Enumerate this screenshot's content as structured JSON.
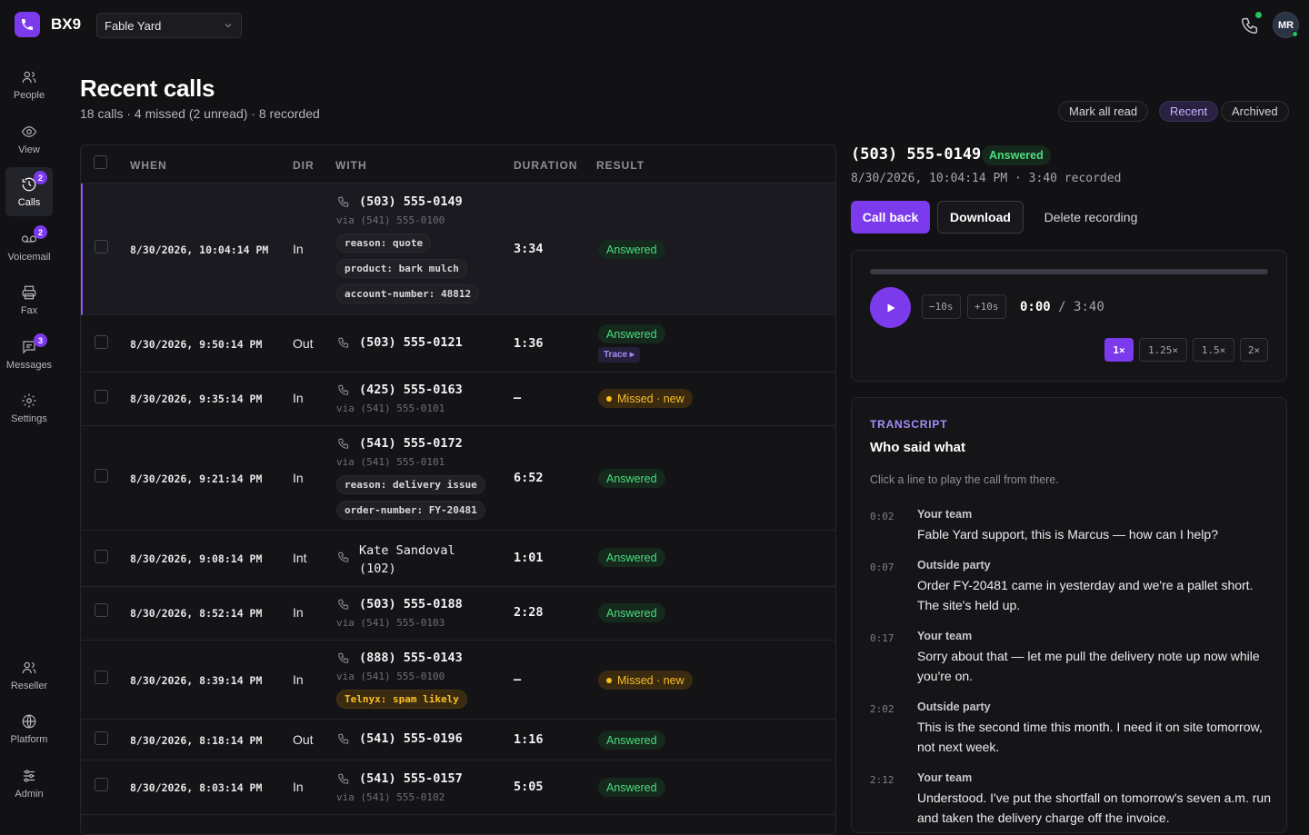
{
  "app": {
    "brand": "BX9",
    "tenant": "Fable Yard",
    "avatar_initials": "MR"
  },
  "sidebar": {
    "items": [
      {
        "label": "People",
        "icon": "people-icon"
      },
      {
        "label": "View",
        "icon": "eye-icon"
      },
      {
        "label": "Calls",
        "icon": "history-icon",
        "badge": "2",
        "active": true
      },
      {
        "label": "Voicemail",
        "icon": "voicemail-icon",
        "badge": "2"
      },
      {
        "label": "Fax",
        "icon": "printer-icon"
      },
      {
        "label": "Messages",
        "icon": "message-icon",
        "badge": "3"
      },
      {
        "label": "Settings",
        "icon": "gear-icon"
      }
    ],
    "bottom": [
      {
        "label": "Reseller",
        "icon": "reseller-icon"
      },
      {
        "label": "Platform",
        "icon": "globe-icon"
      },
      {
        "label": "Admin",
        "icon": "sliders-icon"
      }
    ]
  },
  "page": {
    "title": "Recent calls",
    "subtitle": "18 calls · 4 missed (2 unread) · 8 recorded",
    "actions": {
      "mark_all_read": "Mark all read",
      "recent": "Recent",
      "archived": "Archived"
    }
  },
  "table": {
    "headers": {
      "when": "WHEN",
      "dir": "DIR",
      "with": "WITH",
      "duration": "DURATION",
      "result": "RESULT"
    },
    "rows": [
      {
        "when": "8/30/2026, 10:04:14 PM",
        "dir": "In",
        "number": "(503) 555-0149",
        "via": "via (541) 555-0100",
        "tags": [
          "reason: quote",
          "product: bark mulch",
          "account-number: 48812"
        ],
        "duration": "3:34",
        "result": "Answered"
      },
      {
        "when": "8/30/2026, 9:50:14 PM",
        "dir": "Out",
        "number": "(503) 555-0121",
        "duration": "1:36",
        "result": "Answered",
        "extra": "Trace ▸"
      },
      {
        "when": "8/30/2026, 9:35:14 PM",
        "dir": "In",
        "number": "(425) 555-0163",
        "via": "via (541) 555-0101",
        "duration": "–",
        "result": "Missed · new"
      },
      {
        "when": "8/30/2026, 9:21:14 PM",
        "dir": "In",
        "number": "(541) 555-0172",
        "via": "via (541) 555-0101",
        "tags": [
          "reason: delivery issue",
          "order-number: FY-20481"
        ],
        "duration": "6:52",
        "result": "Answered"
      },
      {
        "when": "8/30/2026, 9:08:14 PM",
        "dir": "Int",
        "number": "Kate Sandoval",
        "number2": "(102)",
        "duration": "1:01",
        "result": "Answered"
      },
      {
        "when": "8/30/2026, 8:52:14 PM",
        "dir": "In",
        "number": "(503) 555-0188",
        "via": "via (541) 555-0103",
        "duration": "2:28",
        "result": "Answered"
      },
      {
        "when": "8/30/2026, 8:39:14 PM",
        "dir": "In",
        "number": "(888) 555-0143",
        "via": "via (541) 555-0100",
        "tags": [
          "Telnyx: spam likely"
        ],
        "duration": "–",
        "result": "Missed · new"
      },
      {
        "when": "8/30/2026, 8:18:14 PM",
        "dir": "Out",
        "number": "(541) 555-0196",
        "duration": "1:16",
        "result": "Answered"
      },
      {
        "when": "8/30/2026, 8:03:14 PM",
        "dir": "In",
        "number": "(541) 555-0157",
        "via": "via (541) 555-0102",
        "duration": "5:05",
        "result": "Answered"
      }
    ]
  },
  "detail": {
    "number": "(503) 555-0149",
    "status": "Answered",
    "meta": "8/30/2026, 10:04:14 PM · 3:40 recorded",
    "buttons": {
      "call_back": "Call back",
      "download": "Download",
      "delete": "Delete recording"
    },
    "player": {
      "back": "−10s",
      "fwd": "+10s",
      "current": "0:00",
      "sep": "/",
      "total": "3:40",
      "progress": 0,
      "speeds": [
        "1×",
        "1.25×",
        "1.5×",
        "2×"
      ],
      "speed_active": "1×"
    },
    "transcript": {
      "eyebrow": "TRANSCRIPT",
      "title": "Who said what",
      "hint": "Click a line to play the call from there.",
      "lines": [
        {
          "t": "0:02",
          "speaker": "Your team",
          "text": "Fable Yard support, this is Marcus — how can I help?"
        },
        {
          "t": "0:07",
          "speaker": "Outside party",
          "text": "Order FY-20481 came in yesterday and we're a pallet short. The site's held up."
        },
        {
          "t": "0:17",
          "speaker": "Your team",
          "text": "Sorry about that — let me pull the delivery note up now while you're on."
        },
        {
          "t": "2:02",
          "speaker": "Outside party",
          "text": "This is the second time this month. I need it on site tomorrow, not next week."
        },
        {
          "t": "2:12",
          "speaker": "Your team",
          "text": "Understood. I've put the shortfall on tomorrow's seven a.m. run and taken the delivery charge off the invoice."
        }
      ]
    }
  },
  "colors": {
    "accent": "#7c3aed",
    "success": "#4ade80",
    "warning": "#fbbf24",
    "online": "#22c55e"
  }
}
